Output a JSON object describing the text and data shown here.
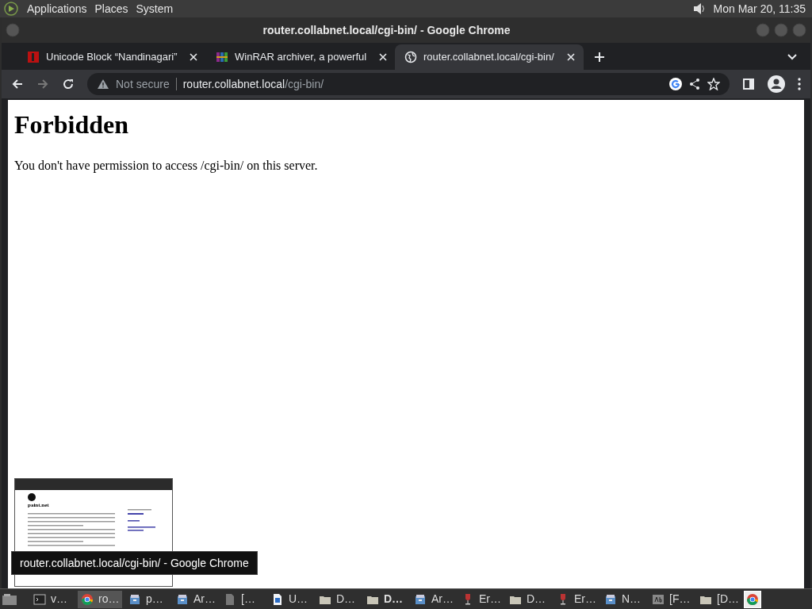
{
  "top_panel": {
    "menus": [
      "Applications",
      "Places",
      "System"
    ],
    "clock": "Mon Mar 20, 11:35"
  },
  "window": {
    "title": "router.collabnet.local/cgi-bin/ - Google Chrome"
  },
  "tabs": [
    {
      "label": "Unicode Block “Nandinagari”",
      "kind": "unicode",
      "selected": false
    },
    {
      "label": "WinRAR archiver, a powerful",
      "kind": "winrar",
      "selected": false
    },
    {
      "label": "router.collabnet.local/cgi-bin/",
      "kind": "globe",
      "selected": true
    }
  ],
  "address_bar": {
    "security": "Not secure",
    "host": "router.collabnet.local",
    "path": "/cgi-bin/"
  },
  "page": {
    "heading": "Forbidden",
    "message": "You don't have permission to access /cgi-bin/ on this server."
  },
  "preview": {
    "heading": "paint.net"
  },
  "tooltip": "router.collabnet.local/cgi-bin/ - Google Chrome",
  "taskbar": [
    {
      "kind": "terminal",
      "label": "v…",
      "selected": false,
      "bold": false
    },
    {
      "kind": "chrome",
      "label": "ro…",
      "selected": true,
      "bold": false
    },
    {
      "kind": "archive",
      "label": "p…",
      "selected": false,
      "bold": false
    },
    {
      "kind": "archive",
      "label": "Ar…",
      "selected": false,
      "bold": false
    },
    {
      "kind": "document",
      "label": "[…",
      "selected": false,
      "bold": false
    },
    {
      "kind": "writer",
      "label": "U…",
      "selected": false,
      "bold": false
    },
    {
      "kind": "folder",
      "label": "D…",
      "selected": false,
      "bold": false
    },
    {
      "kind": "folder",
      "label": "D…",
      "selected": false,
      "bold": true
    },
    {
      "kind": "archive",
      "label": "Ar…",
      "selected": false,
      "bold": false
    },
    {
      "kind": "wine",
      "label": "Er…",
      "selected": false,
      "bold": false
    },
    {
      "kind": "folder",
      "label": "D…",
      "selected": false,
      "bold": false
    },
    {
      "kind": "wine",
      "label": "Er…",
      "selected": false,
      "bold": false
    },
    {
      "kind": "archive",
      "label": "N…",
      "selected": false,
      "bold": false
    },
    {
      "kind": "font",
      "label": "[F…",
      "selected": false,
      "bold": false
    },
    {
      "kind": "folder",
      "label": "[D…",
      "selected": false,
      "bold": false
    }
  ],
  "tray": [
    {
      "kind": "chrome"
    }
  ]
}
